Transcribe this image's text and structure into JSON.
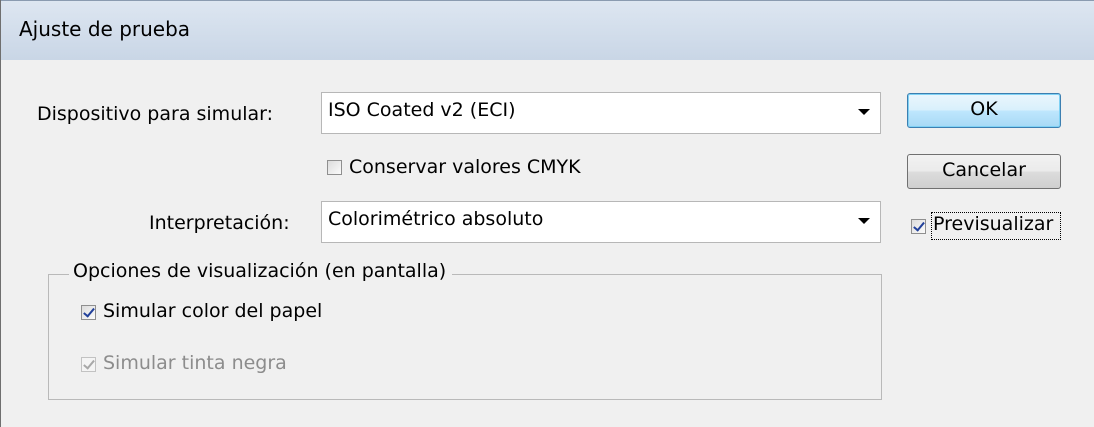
{
  "dialog": {
    "title": "Ajuste de prueba"
  },
  "device": {
    "label": "Dispositivo para simular:",
    "value": "ISO Coated v2 (ECI)"
  },
  "preserve_cmyk": {
    "label": "Conservar valores CMYK",
    "checked": false
  },
  "intent": {
    "label": "Interpretación:",
    "value": "Colorimétrico absoluto"
  },
  "display_options": {
    "legend": "Opciones de visualización (en pantalla)",
    "simulate_paper": {
      "label": "Simular color del papel",
      "checked": true
    },
    "simulate_black_ink": {
      "label": "Simular tinta negra",
      "checked": true,
      "enabled": false
    }
  },
  "buttons": {
    "ok": "OK",
    "cancel": "Cancelar"
  },
  "preview": {
    "label": "Previsualizar",
    "checked": true
  }
}
